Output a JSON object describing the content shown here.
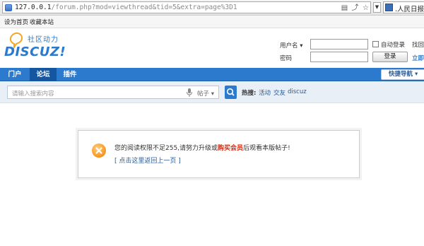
{
  "browser": {
    "url_host": "127.0.0.1",
    "url_path": "/forum.php?mod=viewthread&tid=5&extra=page%3D1",
    "search_engine_text": ".人民日报",
    "bookmarks": [
      "设为首页",
      "收藏本站"
    ]
  },
  "site": {
    "logo_word": "DISCUZ!",
    "logo_slogan": "社区动力",
    "login": {
      "username_label": "用户名",
      "password_label": "密码",
      "auto_login_label": "自动登录",
      "login_button": "登录",
      "find_password_link": "找回",
      "register_link": "立即"
    },
    "nav": {
      "items": [
        "门户",
        "论坛",
        "插件"
      ],
      "active_index": 1,
      "quick_nav_label": "快捷导航"
    },
    "search": {
      "placeholder": "请输入搜索内容",
      "type_label": "帖子",
      "hot_label": "热搜:",
      "hot_terms": [
        "活动",
        "交友",
        "discuz"
      ]
    }
  },
  "message": {
    "text_before": "您的阅读权限不足255,请努力升级或",
    "text_emphasis": "购买会员",
    "text_after": "后观看本版帖子!",
    "back_link": "[ 点击这里返回上一页 ]"
  },
  "colors": {
    "brand_blue": "#2b7acd",
    "nav_active": "#1556a0",
    "alert_red": "#e1260b",
    "warning_orange": "#f7941d"
  }
}
